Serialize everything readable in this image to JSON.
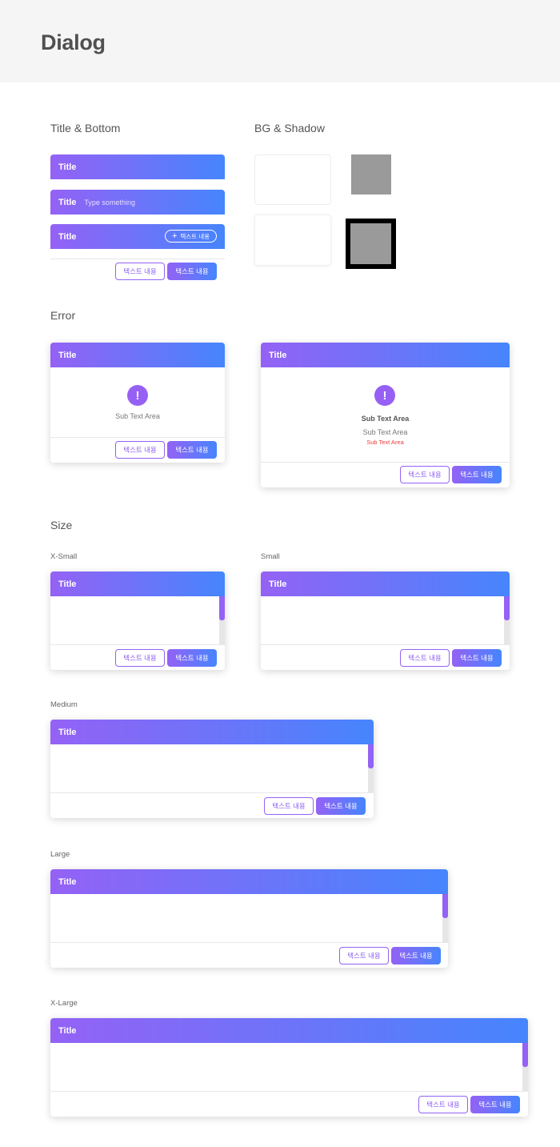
{
  "page": {
    "title": "Dialog"
  },
  "sections": {
    "title_bottom": "Title & Bottom",
    "bg_shadow": "BG & Shadow",
    "error": "Error",
    "size": "Size"
  },
  "dialog": {
    "title": "Title",
    "placeholder": "Type something",
    "add_button": "텍스트 내용",
    "secondary_button": "텍스트 내용",
    "primary_button": "텍스트 내용"
  },
  "error": {
    "icon": "!",
    "sub_text": "Sub Text Area",
    "bold_text": "Sub Text Area",
    "red_text": "Sub Text Area"
  },
  "sizes": {
    "xsmall": "X-Small",
    "small": "Small",
    "medium": "Medium",
    "large": "Large",
    "xlarge": "X-Large"
  },
  "colors": {
    "gradient_start": "#9462f5",
    "gradient_end": "#4685fd",
    "error_red": "#ef3b3b",
    "scroll_thumb": "#9462f5"
  }
}
